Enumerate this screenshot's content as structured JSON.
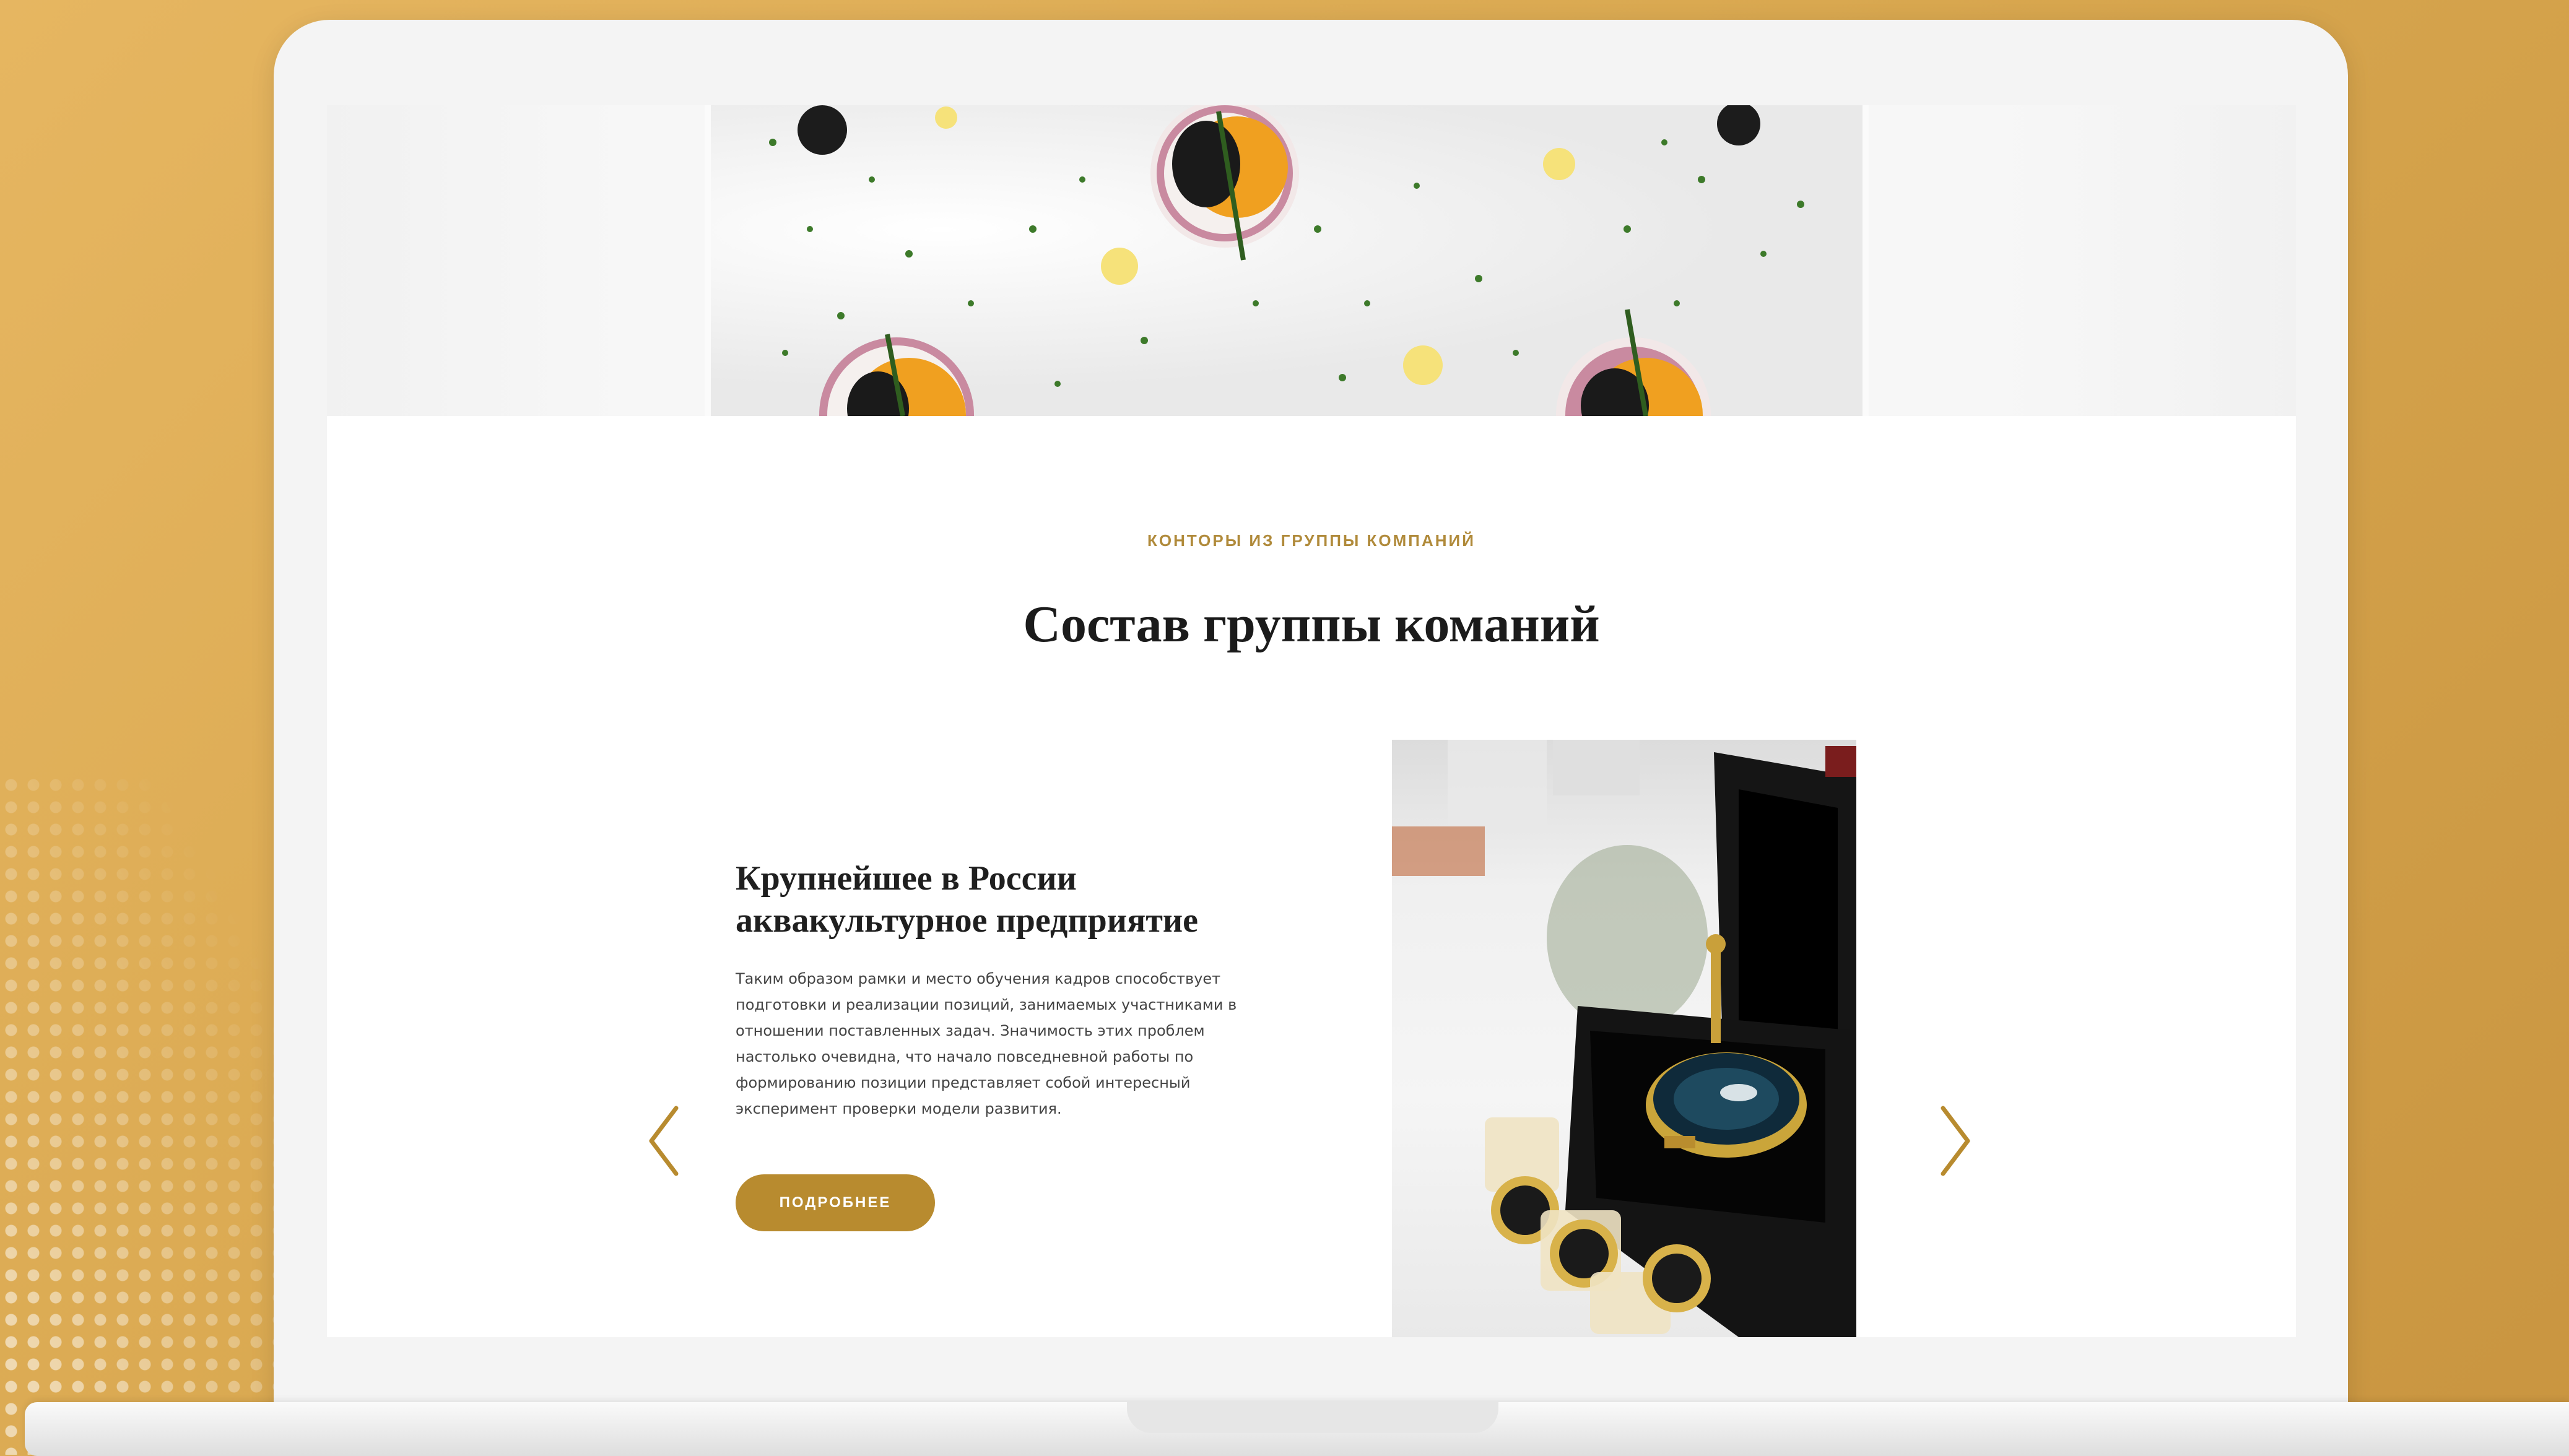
{
  "section": {
    "eyebrow": "КОНТОРЫ ИЗ ГРУППЫ КОМПАНИЙ",
    "title": "Состав группы команий"
  },
  "slide": {
    "title_line1": "Крупнейшее в России",
    "title_line2": "аквакультурное предприятие",
    "text": "Таким образом рамки и место обучения кадров способствует подготовки и реализации позиций, занимаемых участниками в отношении поставленных задач. Значимость этих проблем настолько очевидна, что начало повседневной работы по формированию позиции представляет собой интересный эксперимент проверки модели развития.",
    "button_label": "ПОДРОБНЕЕ"
  },
  "icons": {
    "prev": "chevron-left-icon",
    "next": "chevron-right-icon"
  },
  "colors": {
    "accent": "#b88b2f",
    "eyebrow": "#b08a3a",
    "background": "#d9a850",
    "heading": "#1b1b1b"
  }
}
